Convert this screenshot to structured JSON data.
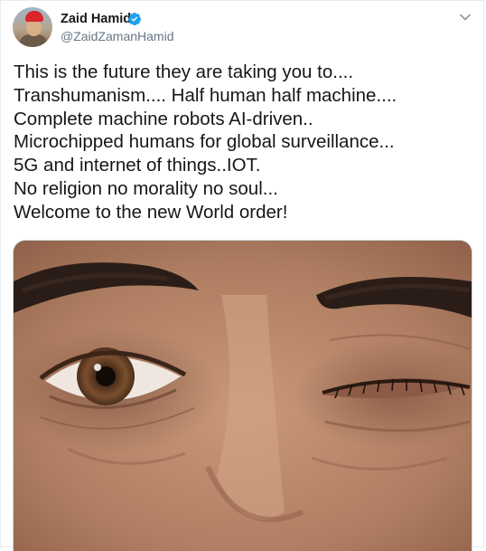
{
  "author": {
    "display_name": "Zaid Hamid",
    "handle": "@ZaidZamanHamid",
    "verified": true
  },
  "tweet": {
    "lines": [
      "This is the future they are taking you to....",
      "Transhumanism.... Half human half machine....",
      "Complete machine robots AI-driven..",
      "Microchipped humans for global surveillance...",
      "5G and internet of things..IOT.",
      "No religion no morality no soul...",
      "Welcome to the new World order!"
    ]
  },
  "icons": {
    "verified": "verified-badge-icon",
    "menu": "chevron-down-icon"
  },
  "colors": {
    "verified_blue": "#1da1f2",
    "handle_gray": "#657786",
    "text_dark": "#14171a",
    "border": "#e6ecf0"
  }
}
